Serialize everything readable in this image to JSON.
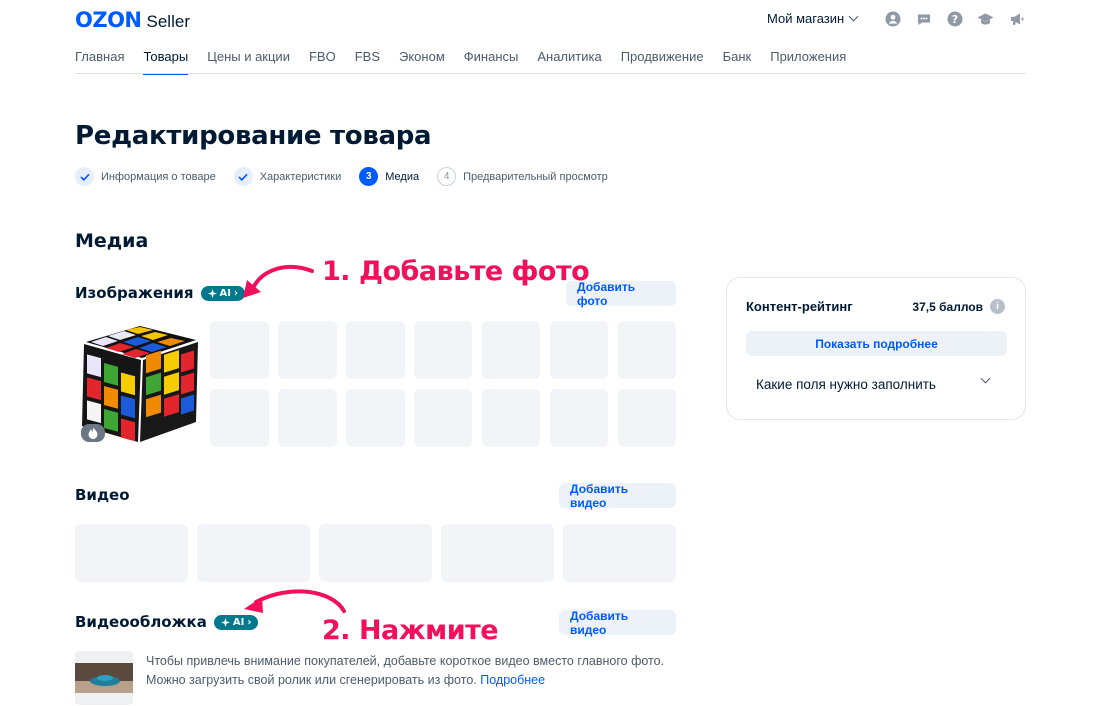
{
  "header": {
    "logo_brand": "OZON",
    "logo_product": "Seller",
    "store_label": "Мой магазин",
    "icons": [
      "user-icon",
      "chat-icon",
      "help-icon",
      "education-icon",
      "announcement-icon"
    ]
  },
  "nav": {
    "items": [
      "Главная",
      "Товары",
      "Цены и акции",
      "FBO",
      "FBS",
      "Эконом",
      "Финансы",
      "Аналитика",
      "Продвижение",
      "Банк",
      "Приложения"
    ],
    "active": "Товары"
  },
  "page": {
    "title": "Редактирование товара",
    "steps": [
      {
        "label": "Информация о товаре",
        "state": "done"
      },
      {
        "label": "Характеристики",
        "state": "done"
      },
      {
        "label": "Медиа",
        "state": "current",
        "number": "3"
      },
      {
        "label": "Предварительный просмотр",
        "state": "todo",
        "number": "4"
      }
    ]
  },
  "media": {
    "heading": "Медиа",
    "images": {
      "label": "Изображения",
      "ai_badge": "AI",
      "button": "Добавить фото"
    },
    "video": {
      "label": "Видео",
      "button": "Добавить видео"
    },
    "cover": {
      "label": "Видеообложка",
      "ai_badge": "AI",
      "button": "Добавить видео",
      "text_line1": "Чтобы привлечь внимание покупателей, добавьте короткое видео вместо главного фото.",
      "text_line2": "Можно загрузить свой ролик или сгенерировать из фото.",
      "link": "Подробнее"
    }
  },
  "rating": {
    "title": "Контент-рейтинг",
    "score": "37,5 баллов",
    "button": "Показать подробнее",
    "question": "Какие поля нужно заполнить"
  },
  "annotations": {
    "step1": "1. Добавьте фото",
    "step2": "2. Нажмите"
  },
  "colors": {
    "accent": "#005bff",
    "ai_badge": "#00798c",
    "annotation": "#f2105c"
  }
}
